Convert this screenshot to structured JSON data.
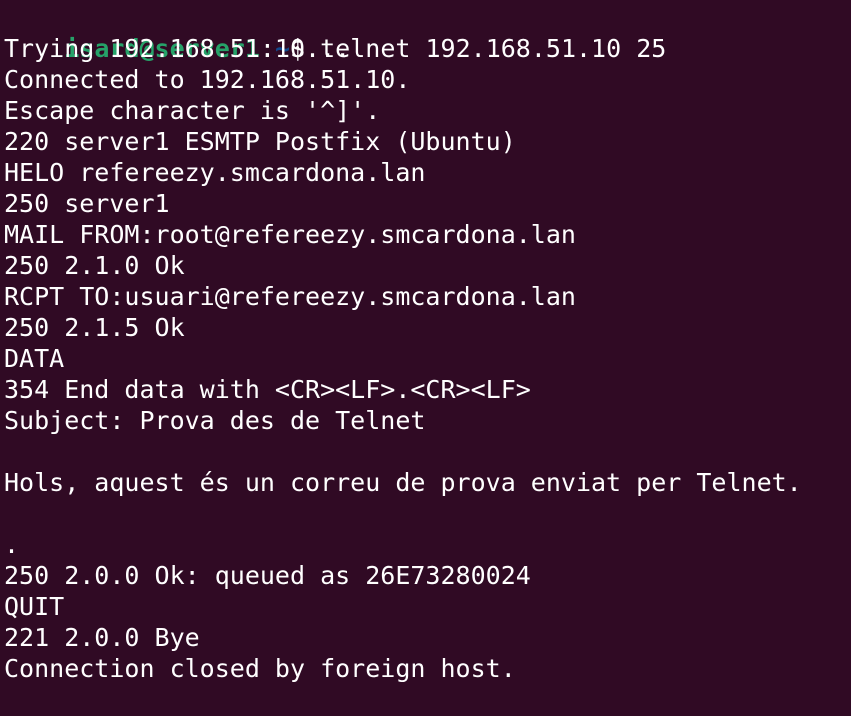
{
  "terminal": {
    "prompt": {
      "user_host": "isard@server1",
      "colon": ":",
      "path": "~",
      "dollar": "$ "
    },
    "command": "telnet 192.168.51.10 25",
    "output": [
      "Trying 192.168.51.10...",
      "Connected to 192.168.51.10.",
      "Escape character is '^]'.",
      "220 server1 ESMTP Postfix (Ubuntu)",
      "HELO refereezy.smcardona.lan",
      "250 server1",
      "MAIL FROM:root@refereezy.smcardona.lan",
      "250 2.1.0 Ok",
      "RCPT TO:usuari@refereezy.smcardona.lan",
      "250 2.1.5 Ok",
      "DATA",
      "354 End data with <CR><LF>.<CR><LF>",
      "Subject: Prova des de Telnet",
      "",
      "Hols, aquest és un correu de prova enviat per Telnet.",
      "",
      ".",
      "250 2.0.0 Ok: queued as 26E73280024",
      "QUIT",
      "221 2.0.0 Bye",
      "Connection closed by foreign host."
    ]
  }
}
